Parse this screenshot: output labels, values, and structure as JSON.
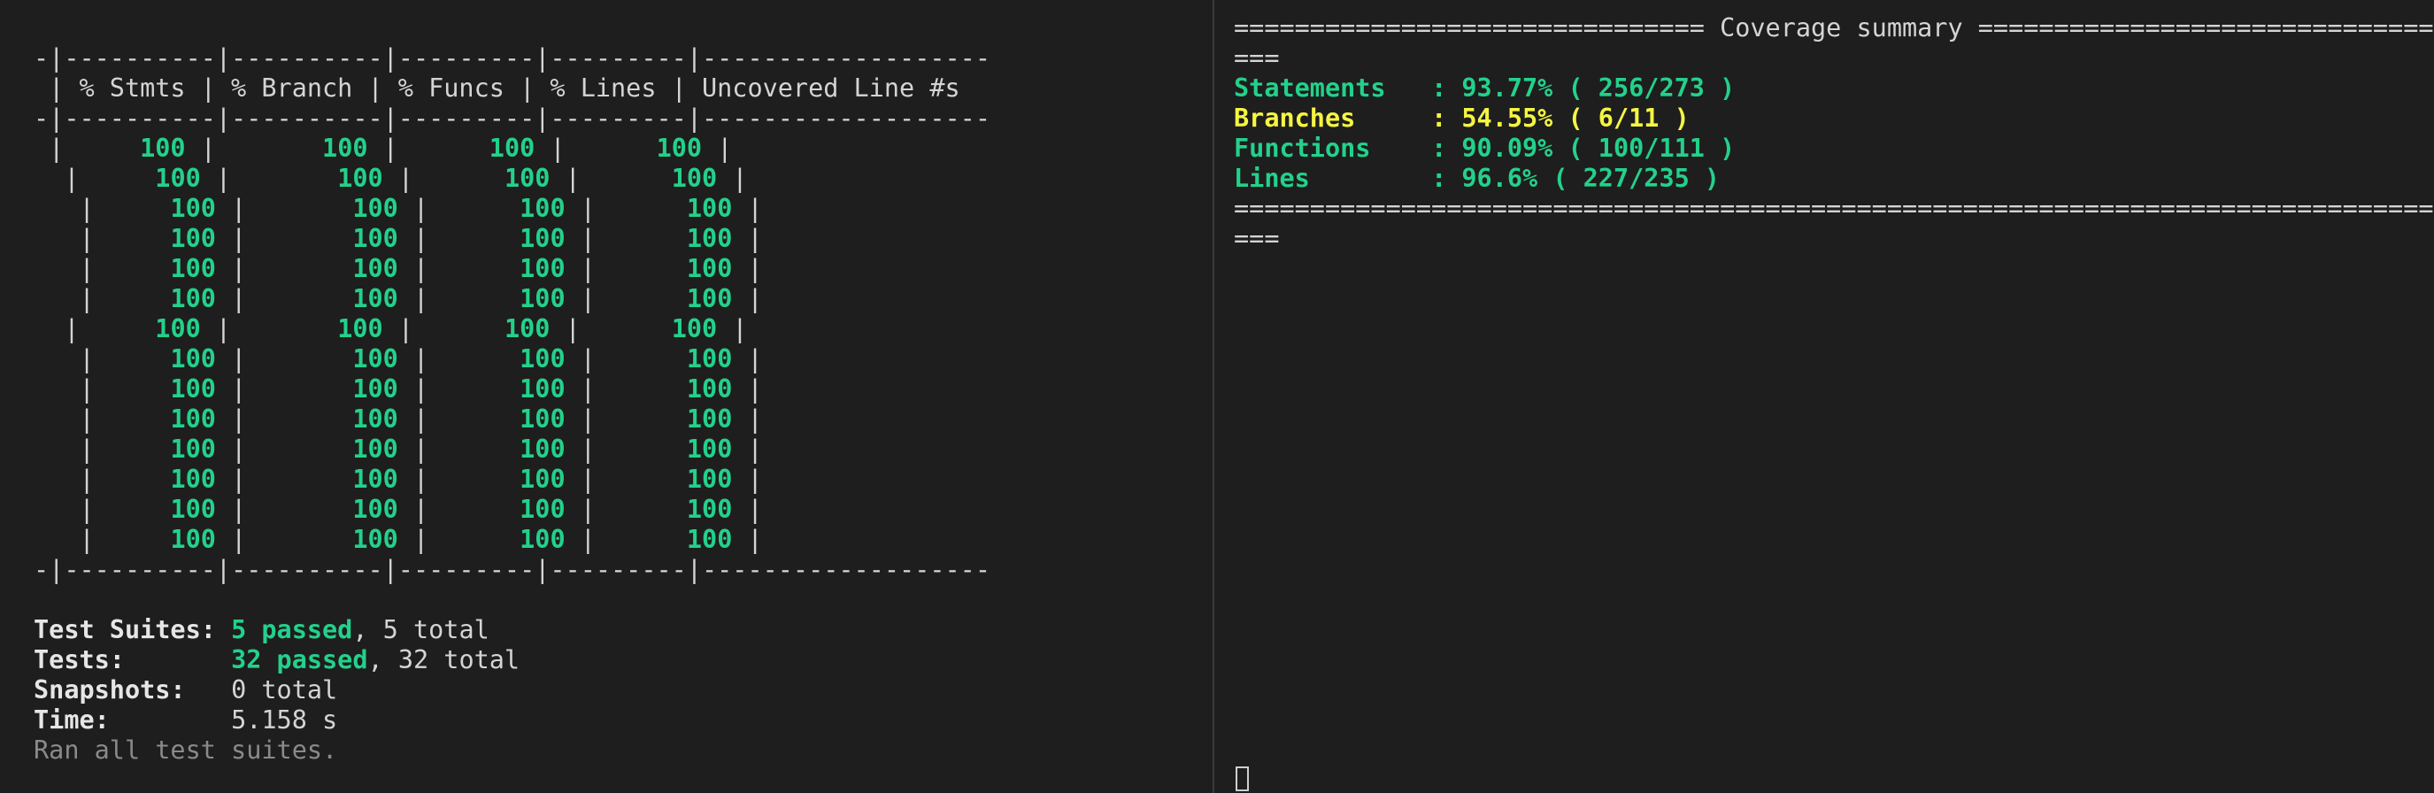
{
  "left_pane": {
    "table": {
      "separator": "-|----------|----------|---------|---------|-------------------",
      "header": " | % Stmts | % Branch | % Funcs | % Lines | Uncovered Line #s",
      "rows": [
        {
          "prefix": " |     ",
          "values": [
            "100",
            "100",
            "100",
            "100"
          ],
          "gaps": [
            " |       ",
            " |      ",
            " |      ",
            " |"
          ]
        },
        {
          "prefix": "  |     ",
          "values": [
            "100",
            "100",
            "100",
            "100"
          ],
          "gaps": [
            " |       ",
            " |      ",
            " |      ",
            " |"
          ]
        },
        {
          "prefix": "   |     ",
          "values": [
            "100",
            "100",
            "100",
            "100"
          ],
          "gaps": [
            " |       ",
            " |      ",
            " |      ",
            " |"
          ]
        },
        {
          "prefix": "   |     ",
          "values": [
            "100",
            "100",
            "100",
            "100"
          ],
          "gaps": [
            " |       ",
            " |      ",
            " |      ",
            " |"
          ]
        },
        {
          "prefix": "   |     ",
          "values": [
            "100",
            "100",
            "100",
            "100"
          ],
          "gaps": [
            " |       ",
            " |      ",
            " |      ",
            " |"
          ]
        },
        {
          "prefix": "   |     ",
          "values": [
            "100",
            "100",
            "100",
            "100"
          ],
          "gaps": [
            " |       ",
            " |      ",
            " |      ",
            " |"
          ]
        },
        {
          "prefix": "  |     ",
          "values": [
            "100",
            "100",
            "100",
            "100"
          ],
          "gaps": [
            " |       ",
            " |      ",
            " |      ",
            " |"
          ]
        },
        {
          "prefix": "   |     ",
          "values": [
            "100",
            "100",
            "100",
            "100"
          ],
          "gaps": [
            " |       ",
            " |      ",
            " |      ",
            " |"
          ]
        },
        {
          "prefix": "   |     ",
          "values": [
            "100",
            "100",
            "100",
            "100"
          ],
          "gaps": [
            " |       ",
            " |      ",
            " |      ",
            " |"
          ]
        },
        {
          "prefix": "   |     ",
          "values": [
            "100",
            "100",
            "100",
            "100"
          ],
          "gaps": [
            " |       ",
            " |      ",
            " |      ",
            " |"
          ]
        },
        {
          "prefix": "   |     ",
          "values": [
            "100",
            "100",
            "100",
            "100"
          ],
          "gaps": [
            " |       ",
            " |      ",
            " |      ",
            " |"
          ]
        },
        {
          "prefix": "   |     ",
          "values": [
            "100",
            "100",
            "100",
            "100"
          ],
          "gaps": [
            " |       ",
            " |      ",
            " |      ",
            " |"
          ]
        },
        {
          "prefix": "   |     ",
          "values": [
            "100",
            "100",
            "100",
            "100"
          ],
          "gaps": [
            " |       ",
            " |      ",
            " |      ",
            " |"
          ]
        },
        {
          "prefix": "   |     ",
          "values": [
            "100",
            "100",
            "100",
            "100"
          ],
          "gaps": [
            " |       ",
            " |      ",
            " |      ",
            " |"
          ]
        }
      ]
    },
    "summary": {
      "suites_label": "Test Suites:",
      "suites_passed": "5 passed",
      "suites_total": ", 5 total",
      "tests_label": "Tests:",
      "tests_passed": "32 passed",
      "tests_total": ", 32 total",
      "snapshots_label": "Snapshots:",
      "snapshots_value": "0 total",
      "time_label": "Time:",
      "time_value": "5.158 s",
      "ran_all": "Ran all test suites."
    }
  },
  "right_pane": {
    "header_line": "=============================== Coverage summary ===============================",
    "header_wrap": "===",
    "statements_label": "Statements   ",
    "statements_value": ": 93.77% ( 256/273 )",
    "branches_label": "Branches     ",
    "branches_value": ": 54.55% ( 6/11 )",
    "functions_label": "Functions    ",
    "functions_value": ": 90.09% ( 100/111 )",
    "lines_label": "Lines        ",
    "lines_value": ": 96.6% ( 227/235 )",
    "footer_line": "================================================================================",
    "footer_wrap": "==="
  },
  "colors": {
    "background": "#1e1e1e",
    "text": "#d4d4d4",
    "green": "#23d18b",
    "yellow": "#f5f543",
    "dim": "#8a8a8a"
  }
}
